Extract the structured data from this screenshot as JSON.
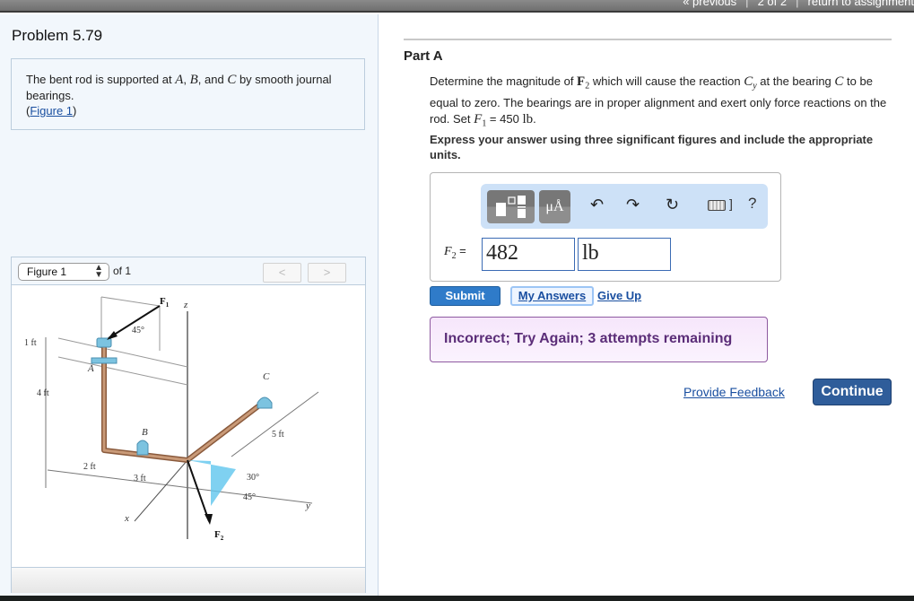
{
  "topnav": {
    "previous": "« previous",
    "page_indicator": "2 of 2",
    "return": "return to assignment",
    "separator": "|"
  },
  "problem": {
    "title": "Problem 5.79",
    "description_prefix": "The bent rod is supported at ",
    "var_a": "A",
    "comma1": ", ",
    "var_b": "B",
    "and": ", and ",
    "var_c": "C",
    "description_suffix": " by smooth journal bearings.",
    "figure_link_open": "(",
    "figure_link": "Figure 1",
    "figure_link_close": ")"
  },
  "figure_panel": {
    "selected": "Figure 1",
    "of_label": "of 1",
    "prev_icon": "chevron-left-icon",
    "next_icon": "chevron-right-icon",
    "prev_glyph": "<",
    "next_glyph": ">",
    "labels": {
      "f1": "F",
      "f1_sub": "1",
      "f2": "F",
      "f2_sub": "2",
      "z": "z",
      "x": "x",
      "y": "y",
      "a": "A",
      "b": "B",
      "c": "C",
      "angle1": "45°",
      "angle2": "30°",
      "angle3": "45°",
      "dim_1ft": "1 ft",
      "dim_4ft": "4 ft",
      "dim_2ft": "2 ft",
      "dim_3ft": "3 ft",
      "dim_5ft": "5 ft"
    }
  },
  "part": {
    "title": "Part A",
    "q_1": "Determine the magnitude of ",
    "q_f2": "F",
    "q_f2_sub": "2",
    "q_2": " which will cause the reaction ",
    "q_cy": "C",
    "q_cy_sub": "y",
    "q_3": " at the bearing ",
    "q_c": "C",
    "q_4": " to be equal to zero. The bearings are in proper alignment and exert only force reactions on the rod. Set ",
    "q_f1": "F",
    "q_f1_sub": "1",
    "q_5": " = 450 ",
    "q_unit": "lb",
    "q_6": ".",
    "instruction": "Express your answer using three significant figures and include the appropriate units."
  },
  "answer": {
    "toolbar": {
      "templates_icon": "templates-icon",
      "units_label": "μÅ",
      "undo_icon": "undo-icon",
      "redo_icon": "redo-icon",
      "reset_icon": "reset-icon",
      "keyboard_icon": "keyboard-icon",
      "help_label": "?",
      "undo_glyph": "↶",
      "redo_glyph": "↷",
      "reset_glyph": "↻"
    },
    "variable": "F",
    "variable_sub": "2",
    "equals": " =",
    "value": "482",
    "unit": "lb"
  },
  "actions": {
    "submit": "Submit",
    "my_answers": "My Answers",
    "give_up": "Give Up"
  },
  "feedback": {
    "message": "Incorrect; Try Again; 3 attempts remaining"
  },
  "footer": {
    "provide_feedback": "Provide Feedback",
    "continue": "Continue"
  },
  "colors": {
    "submit": "#2f7bc9",
    "continue": "#2f5d9a",
    "feedback_text": "#5b2d78",
    "link": "#1a4fa0"
  }
}
